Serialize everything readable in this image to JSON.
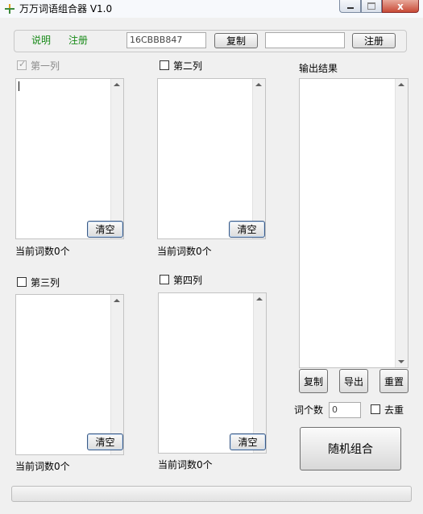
{
  "window": {
    "title": "万万词语组合器 V1.0",
    "close_glyph": "x"
  },
  "top": {
    "help_label": "说明",
    "register_link_label": "注册",
    "machine_code": "16CBBB847",
    "copy_label": "复制",
    "reg_input_value": "",
    "register_button_label": "注册"
  },
  "columns": [
    {
      "label": "第一列",
      "clear_label": "清空",
      "count_text": "当前词数0个",
      "checked": true,
      "disabled": true
    },
    {
      "label": "第二列",
      "clear_label": "清空",
      "count_text": "当前词数0个",
      "checked": false,
      "disabled": false
    },
    {
      "label": "第三列",
      "clear_label": "清空",
      "count_text": "当前词数0个",
      "checked": false,
      "disabled": false
    },
    {
      "label": "第四列",
      "clear_label": "清空",
      "count_text": "当前词数0个",
      "checked": false,
      "disabled": false
    }
  ],
  "output": {
    "label": "输出结果",
    "copy_label": "复制",
    "export_label": "导出",
    "reset_label": "重置",
    "word_count_label": "词个数",
    "word_count_value": "0",
    "dedupe_label": "去重",
    "random_combine_label": "随机组合"
  },
  "progress": {
    "value": 0
  }
}
